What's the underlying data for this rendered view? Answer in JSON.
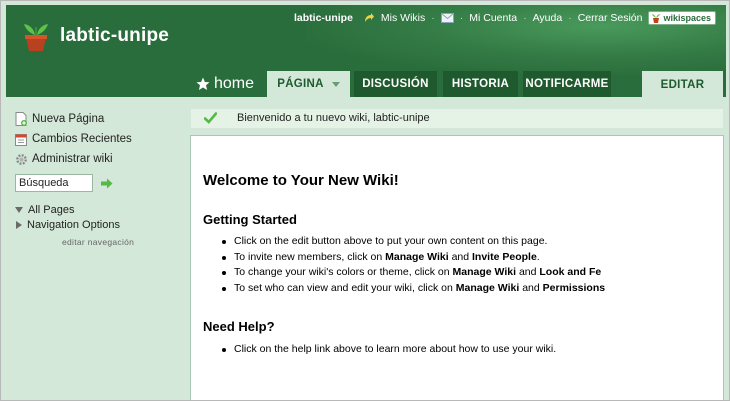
{
  "colors": {
    "header_green": "#2a6d3c",
    "tab_dark": "#1f5a2f",
    "sidebar_bg": "#d3e8d8",
    "flash_bg": "#e4f3e6",
    "accent_green": "#58b846"
  },
  "header": {
    "site_title": "labtic-unipe",
    "topnav": {
      "username": "labtic-unipe",
      "my_wikis": "Mis Wikis",
      "my_account": "Mi Cuenta",
      "help": "Ayuda",
      "sign_out": "Cerrar Sesión",
      "separator": "·",
      "brand": "wikispaces"
    }
  },
  "tabs": {
    "home": "home",
    "page": "PÁGINA",
    "discussion": "DISCUSIÓN",
    "history": "HISTORIA",
    "notify": "NOTIFICARME",
    "edit": "EDITAR"
  },
  "sidebar": {
    "new_page": "Nueva Página",
    "recent_changes": "Cambios Recientes",
    "manage_wiki": "Administrar wiki",
    "search_value": "Búsqueda",
    "all_pages": "All Pages",
    "navigation_options": "Navigation Options",
    "edit_navigation": "editar navegación"
  },
  "flash": {
    "message": "Bienvenido a tu nuevo wiki, labtic-unipe"
  },
  "content": {
    "title": "Welcome to Your New Wiki!",
    "getting_started": {
      "heading": "Getting Started",
      "items": [
        {
          "text": "Click on the edit button above to put your own content on this page."
        },
        {
          "pre": "To invite new members, click on ",
          "b1": "Manage Wiki",
          "mid": " and ",
          "b2": "Invite People",
          "post": "."
        },
        {
          "pre": "To change your wiki's colors or theme, click on ",
          "b1": "Manage Wiki",
          "mid": " and ",
          "b2": "Look and Fe"
        },
        {
          "pre": "To set who can view and edit your wiki, click on ",
          "b1": "Manage Wiki",
          "mid": " and ",
          "b2": "Permissions"
        }
      ]
    },
    "need_help": {
      "heading": "Need Help?",
      "items": [
        {
          "text": "Click on the help link above to learn more about how to use your wiki."
        }
      ]
    }
  },
  "icons": {
    "logo": "potted-plant-icon",
    "my_wikis": "green-arrow-icon",
    "messages": "envelope-icon",
    "new_page": "new-page-icon",
    "recent_changes": "calendar-icon",
    "manage_wiki": "gear-icon",
    "search_go": "green-arrow-icon",
    "flash": "checkmark-icon",
    "home": "star-icon"
  }
}
